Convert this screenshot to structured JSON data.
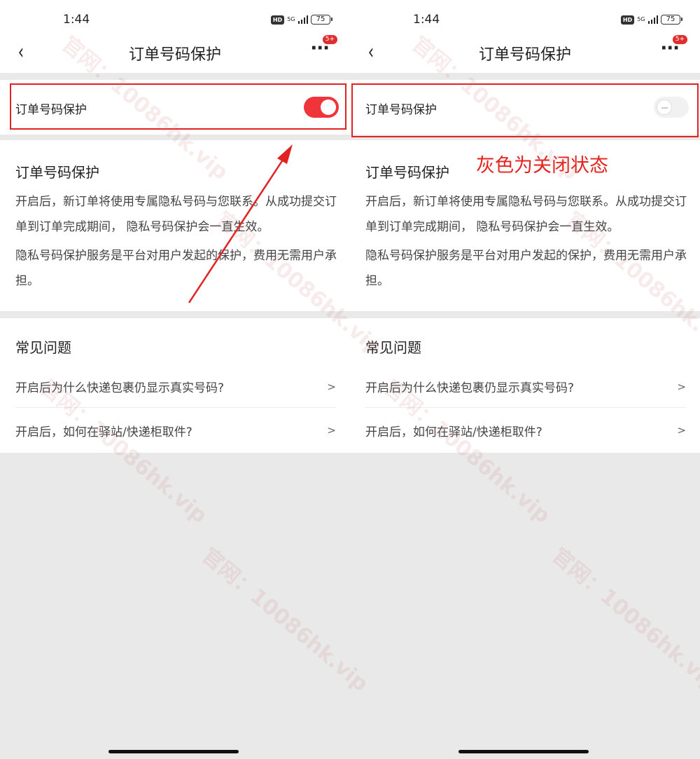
{
  "panels": [
    {
      "status": {
        "time": "1:44",
        "hd": "HD",
        "network": "5G",
        "battery": "75"
      },
      "nav": {
        "back": "‹",
        "title": "订单号码保护",
        "more": "···",
        "badge": "5+"
      },
      "toggle": {
        "label": "订单号码保护",
        "state": "on"
      },
      "desc": {
        "title": "订单号码保护",
        "p1": "开启后，新订单将使用专属隐私号码与您联系。从成功提交订单到订单完成期间， 隐私号码保护会一直生效。",
        "p2": "隐私号码保护服务是平台对用户发起的保护，费用无需用户承担。"
      },
      "faq": {
        "title": "常见问题",
        "items": [
          {
            "label": "开启后为什么快递包裹仍显示真实号码?",
            "chevron": ">"
          },
          {
            "label": "开启后，如何在驿站/快递柜取件?",
            "chevron": ">"
          }
        ]
      }
    },
    {
      "status": {
        "time": "1:44",
        "hd": "HD",
        "network": "5G",
        "battery": "75"
      },
      "nav": {
        "back": "‹",
        "title": "订单号码保护",
        "more": "···",
        "badge": "5+"
      },
      "toggle": {
        "label": "订单号码保护",
        "state": "off"
      },
      "desc": {
        "title": "订单号码保护",
        "p1": "开启后，新订单将使用专属隐私号码与您联系。从成功提交订单到订单完成期间， 隐私号码保护会一直生效。",
        "p2": "隐私号码保护服务是平台对用户发起的保护，费用无需用户承担。"
      },
      "annotation": "灰色为关闭状态",
      "faq": {
        "title": "常见问题",
        "items": [
          {
            "label": "开启后为什么快递包裹仍显示真实号码?",
            "chevron": ">"
          },
          {
            "label": "开启后，如何在驿站/快递柜取件?",
            "chevron": ">"
          }
        ]
      }
    }
  ],
  "watermark": "官网：10086hk.vip",
  "colors": {
    "accent": "#f0353a",
    "annotation": "#e5231f",
    "highlight": "#e02222"
  }
}
